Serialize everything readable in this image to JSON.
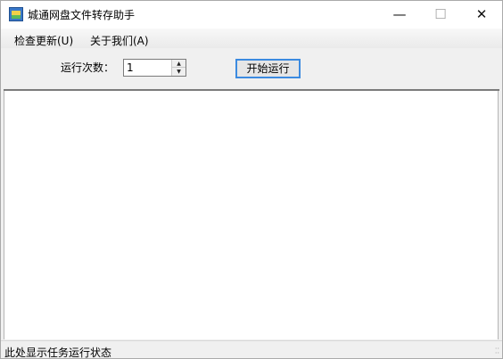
{
  "window": {
    "title": "城通网盘文件转存助手",
    "minimize": "—",
    "maximize": "☐",
    "close": "✕"
  },
  "menu": [
    "检查更新(U)",
    "关于我们(A)"
  ],
  "toolbar": {
    "run_label": "运行次数：",
    "run_count": "1",
    "start_button": "开始运行"
  },
  "status": {
    "text": "此处显示任务运行状态"
  }
}
